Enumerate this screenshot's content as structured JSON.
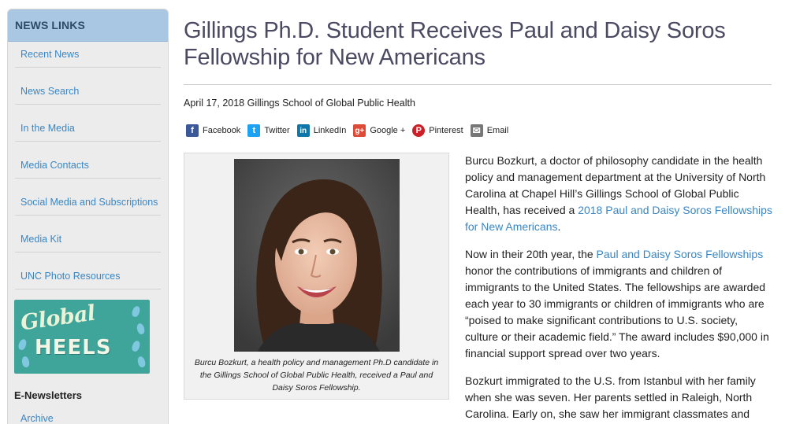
{
  "sidebar": {
    "header": "NEWS LINKS",
    "items": [
      {
        "label": "Recent News"
      },
      {
        "label": "News Search"
      },
      {
        "label": "In the Media"
      },
      {
        "label": "Media Contacts"
      },
      {
        "label": "Social Media and Subscriptions"
      },
      {
        "label": "Media Kit"
      },
      {
        "label": "UNC Photo Resources"
      }
    ],
    "banner": {
      "line1": "Global",
      "line2": "HEELS"
    },
    "enewsletters": {
      "title": "E-Newsletters",
      "archive": "Archive"
    }
  },
  "article": {
    "title": "Gillings Ph.D. Student Receives Paul and Daisy Soros Fellowship for New Americans",
    "dateline": "April 17, 2018 Gillings School of Global Public Health",
    "share": [
      {
        "label": "Facebook",
        "icon": "facebook-icon",
        "color": "#3b5998",
        "glyph": "f"
      },
      {
        "label": "Twitter",
        "icon": "twitter-icon",
        "color": "#1da1f2",
        "glyph": "t"
      },
      {
        "label": "LinkedIn",
        "icon": "linkedin-icon",
        "color": "#0e76a8",
        "glyph": "in"
      },
      {
        "label": "Google +",
        "icon": "google-plus-icon",
        "color": "#dd4b39",
        "glyph": "g+"
      },
      {
        "label": "Pinterest",
        "icon": "pinterest-icon",
        "color": "#cb2027",
        "glyph": "P"
      },
      {
        "label": "Email",
        "icon": "email-icon",
        "color": "#777777",
        "glyph": "✉"
      }
    ],
    "caption": "Burcu Bozkurt, a health policy and management Ph.D candidate in the Gillings School of Global Public Health, received a Paul and Daisy Soros Fellowship.",
    "p1": {
      "before": "Burcu Bozkurt, a doctor of philosophy candidate in the health policy and management department at the University of North Carolina at Chapel Hill’s Gillings School of Global Public Health, has received a ",
      "link": "2018 Paul and Daisy Soros Fellowships for New Americans",
      "after": "."
    },
    "p2": {
      "before": "Now in their 20th year, the ",
      "link": "Paul and Daisy Soros Fellowships",
      "after": " honor the contributions of immigrants and children of immigrants to the United States. The fellowships are awarded each year to 30 immigrants or children of immigrants who are “poised to make significant contributions to U.S. society, culture or their academic field.” The award includes $90,000 in financial support spread over two years."
    },
    "p3": "Bozkurt immigrated to the U.S. from Istanbul with her family when she was seven. Her parents settled in Raleigh, North Carolina. Early on, she saw her immigrant classmates and"
  },
  "colors": {
    "link": "#3a86c5",
    "title": "#4c4a63",
    "sidebar_header_bg": "#a9c7e3",
    "banner_bg": "#3fa59a"
  }
}
